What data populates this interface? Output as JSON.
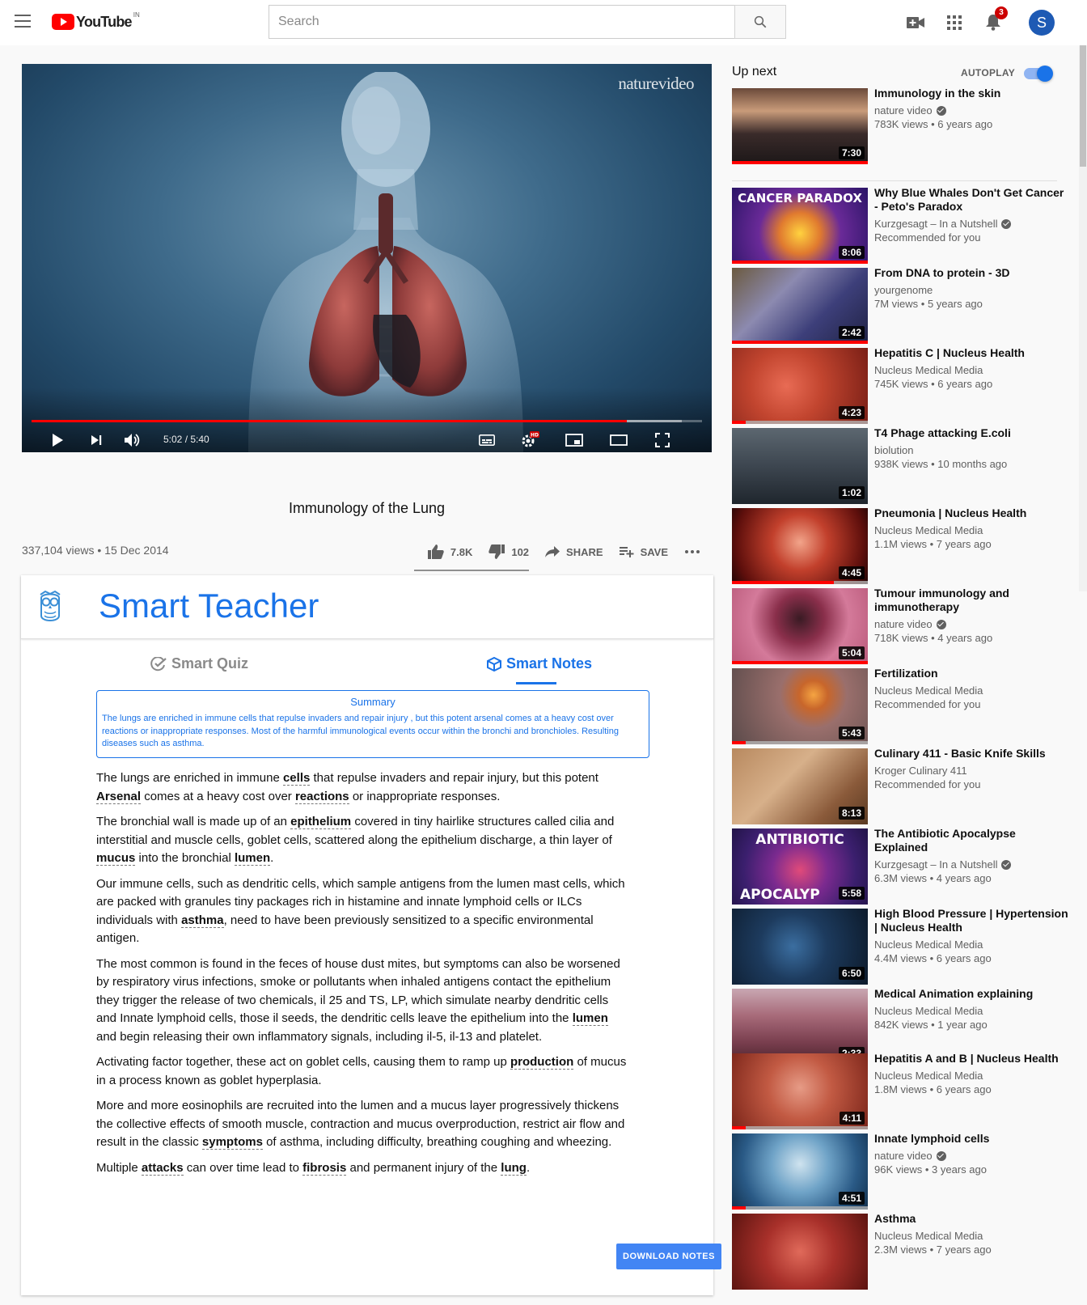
{
  "header": {
    "logo_text": "YouTube",
    "logo_region": "IN",
    "search_placeholder": "Search",
    "notification_count": "3",
    "avatar_letter": "S"
  },
  "player": {
    "watermark_brand": "nature",
    "watermark_suffix": "video",
    "time_display": "5:02 / 5:40",
    "progress_played_fraction": 0.888,
    "progress_buffered_fraction": 0.97
  },
  "video": {
    "title": "Immunology of the Lung",
    "views_date": "337,104 views • 15 Dec 2014",
    "likes": "7.8K",
    "dislikes": "102",
    "share_label": "SHARE",
    "save_label": "SAVE"
  },
  "smart_teacher": {
    "title": "Smart Teacher",
    "tab_quiz": "Smart Quiz",
    "tab_notes": "Smart Notes",
    "summary_title": "Summary",
    "summary_text": "The lungs are enriched in immune cells that repulse invaders and repair injury , but this potent arsenal comes at a heavy cost over reactions or inappropriate responses. Most of the harmful immunological events occur within the bronchi and bronchioles. Resulting diseases such as asthma.",
    "download_label": "DOWNLOAD NOTES",
    "paragraphs": [
      [
        {
          "t": "The lungs are enriched in immune "
        },
        {
          "t": "cells",
          "k": true
        },
        {
          "t": " that repulse invaders and repair injury, but this potent "
        },
        {
          "t": "Arsenal",
          "k": true
        },
        {
          "t": " comes at a heavy cost over "
        },
        {
          "t": "reactions",
          "k": true
        },
        {
          "t": " or inappropriate responses."
        }
      ],
      [
        {
          "t": "The bronchial wall is made up of an "
        },
        {
          "t": "epithelium",
          "k": true
        },
        {
          "t": " covered in tiny hairlike structures called cilia and interstitial and muscle cells, goblet cells, scattered along the epithelium discharge, a thin layer of "
        },
        {
          "t": "mucus",
          "k": true
        },
        {
          "t": " into the bronchial "
        },
        {
          "t": "lumen",
          "k": true
        },
        {
          "t": "."
        }
      ],
      [
        {
          "t": "Our immune cells, such as dendritic cells, which sample antigens from the lumen mast cells, which are packed with granules tiny packages rich in histamine and innate lymphoid cells or ILCs individuals with "
        },
        {
          "t": "asthma",
          "k": true
        },
        {
          "t": ", need to have been previously sensitized to a specific environmental antigen."
        }
      ],
      [
        {
          "t": "The most common is found in the feces of house dust mites, but symptoms can also be worsened by respiratory virus infections, smoke or pollutants when inhaled antigens contact the epithelium they trigger the release of two chemicals, il 25 and TS, LP, which simulate nearby dendritic cells and Innate lymphoid cells, those il seeds, the dendritic cells leave the epithelium into the "
        },
        {
          "t": "lumen",
          "k": true
        },
        {
          "t": " and begin releasing their own inflammatory signals, including il-5, il-13 and platelet."
        }
      ],
      [
        {
          "t": "Activating factor together, these act on goblet cells, causing them to ramp up "
        },
        {
          "t": "production",
          "k": true
        },
        {
          "t": " of mucus in a process known as goblet hyperplasia."
        }
      ],
      [
        {
          "t": "More and more eosinophils are recruited into the lumen and a mucus layer progressively thickens the collective effects of smooth muscle, contraction and mucus overproduction, restrict air flow and result in the classic "
        },
        {
          "t": "symptoms",
          "k": true
        },
        {
          "t": " of asthma, including difficulty, breathing coughing and wheezing."
        }
      ],
      [
        {
          "t": "Multiple "
        },
        {
          "t": "attacks",
          "k": true
        },
        {
          "t": " can over time lead to "
        },
        {
          "t": "fibrosis",
          "k": true
        },
        {
          "t": " and permanent injury of the "
        },
        {
          "t": "lung",
          "k": true
        },
        {
          "t": "."
        }
      ]
    ]
  },
  "sidebar": {
    "up_next_label": "Up next",
    "autoplay_label": "AUTOPLAY",
    "autoplay_on": true,
    "videos": [
      {
        "title": "Immunology in the skin",
        "channel": "nature video",
        "verified": true,
        "meta": "783K views • 6 years ago",
        "duration": "7:30",
        "watched": 1.0,
        "theme": "skin"
      },
      {
        "title": "Why Blue Whales Don't Get Cancer - Peto's Paradox",
        "channel": "Kurzgesagt – In a Nutshell",
        "verified": true,
        "meta": "Recommended for you",
        "duration": "8:06",
        "watched": 1.0,
        "theme": "cancer",
        "overlay": "CANCER PARADOX"
      },
      {
        "title": "From DNA to protein - 3D",
        "channel": "yourgenome",
        "verified": false,
        "meta": "7M views • 5 years ago",
        "duration": "2:42",
        "watched": 1.0,
        "theme": "dna"
      },
      {
        "title": "Hepatitis C | Nucleus Health",
        "channel": "Nucleus Medical Media",
        "verified": false,
        "meta": "745K views • 6 years ago",
        "duration": "4:23",
        "watched": 0.1,
        "theme": "hepc"
      },
      {
        "title": "T4 Phage attacking E.coli",
        "channel": "biolution",
        "verified": false,
        "meta": "938K views • 10 months ago",
        "duration": "1:02",
        "watched": 0,
        "theme": "phage"
      },
      {
        "title": "Pneumonia | Nucleus Health",
        "channel": "Nucleus Medical Media",
        "verified": false,
        "meta": "1.1M views • 7 years ago",
        "duration": "4:45",
        "watched": 0.75,
        "theme": "pneu"
      },
      {
        "title": "Tumour immunology and immunotherapy",
        "channel": "nature video",
        "verified": true,
        "meta": "718K views • 4 years ago",
        "duration": "5:04",
        "watched": 1.0,
        "theme": "tumour"
      },
      {
        "title": "Fertilization",
        "channel": "Nucleus Medical Media",
        "verified": false,
        "meta": "Recommended for you",
        "duration": "5:43",
        "watched": 0.1,
        "theme": "fert"
      },
      {
        "title": "Culinary 411 - Basic Knife Skills",
        "channel": "Kroger Culinary 411",
        "verified": false,
        "meta": "Recommended for you",
        "duration": "8:13",
        "watched": 0,
        "theme": "knife"
      },
      {
        "title": "The Antibiotic Apocalypse Explained",
        "channel": "Kurzgesagt – In a Nutshell",
        "verified": true,
        "meta": "6.3M views • 4 years ago",
        "duration": "5:58",
        "watched": 0,
        "theme": "antibiotic",
        "overlay": "ANTIBIOTIC",
        "overlay2": "APOCALYP"
      },
      {
        "title": "High Blood Pressure | Hypertension | Nucleus Health",
        "channel": "Nucleus Medical Media",
        "verified": false,
        "meta": "4.4M views • 6 years ago",
        "duration": "6:50",
        "watched": 0,
        "theme": "bp"
      },
      {
        "title": "Medical Animation explaining",
        "channel": "Nucleus Medical Media",
        "verified": false,
        "meta": "842K views • 1 year ago",
        "duration": "2:33",
        "watched": 0.1,
        "theme": "med"
      },
      {
        "title": "Hepatitis A and B | Nucleus Health",
        "channel": "Nucleus Medical Media",
        "verified": false,
        "meta": "1.8M views • 6 years ago",
        "duration": "4:11",
        "watched": 0.1,
        "theme": "hepab"
      },
      {
        "title": "Innate lymphoid cells",
        "channel": "nature video",
        "verified": true,
        "meta": "96K views • 3 years ago",
        "duration": "4:51",
        "watched": 0.1,
        "theme": "ilc"
      },
      {
        "title": "Asthma",
        "channel": "Nucleus Medical Media",
        "verified": false,
        "meta": "2.3M views • 7 years ago",
        "duration": "",
        "watched": 0,
        "theme": "asthma"
      }
    ]
  },
  "colors": {
    "accent_blue": "#1a73e8",
    "youtube_red": "#ff0000",
    "download_button": "#4285f4"
  }
}
